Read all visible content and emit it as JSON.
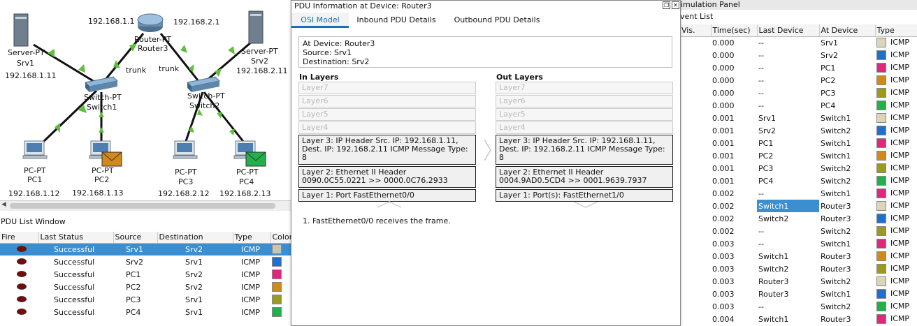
{
  "topology": {
    "router": {
      "name": "Router-PT",
      "label": "Router3",
      "ip_left": "192.168.1.1",
      "ip_right": "192.168.2.1"
    },
    "servers": [
      {
        "type": "Server-PT",
        "name": "Srv1",
        "ip": "192.168.1.11"
      },
      {
        "type": "Server-PT",
        "name": "Srv2",
        "ip": "192.168.2.11"
      }
    ],
    "switches": [
      {
        "type": "Switch-PT",
        "name": "Switch1"
      },
      {
        "type": "Switch-PT",
        "name": "Switch2"
      }
    ],
    "trunk_left": "trunk",
    "trunk_right": "trunk",
    "pcs": [
      {
        "type": "PC-PT",
        "name": "PC1",
        "ip": "192.168.1.12"
      },
      {
        "type": "PC-PT",
        "name": "PC2",
        "ip": "192.168.1.13"
      },
      {
        "type": "PC-PT",
        "name": "PC3",
        "ip": "192.168.2.12"
      },
      {
        "type": "PC-PT",
        "name": "PC4",
        "ip": "192.168.2.13"
      }
    ],
    "link_color": "#5fbf3a",
    "envelope_colors": {
      "pc2": "#d08a1c",
      "pc4": "#22b04a"
    }
  },
  "pdu_list": {
    "title": "PDU List Window",
    "columns": [
      "Fire",
      "Last Status",
      "Source",
      "Destination",
      "Type",
      "Color"
    ],
    "rows": [
      {
        "status": "Successful",
        "source": "Srv1",
        "destination": "Srv2",
        "type": "ICMP",
        "color": "#c9c5b0"
      },
      {
        "status": "Successful",
        "source": "Srv2",
        "destination": "Srv1",
        "type": "ICMP",
        "color": "#1f6fd0"
      },
      {
        "status": "Successful",
        "source": "PC1",
        "destination": "Srv2",
        "type": "ICMP",
        "color": "#e0287a"
      },
      {
        "status": "Successful",
        "source": "PC2",
        "destination": "Srv2",
        "type": "ICMP",
        "color": "#d08a1c"
      },
      {
        "status": "Successful",
        "source": "PC3",
        "destination": "Srv1",
        "type": "ICMP",
        "color": "#9a9a1c"
      },
      {
        "status": "Successful",
        "source": "PC4",
        "destination": "Srv1",
        "type": "ICMP",
        "color": "#22b04a"
      }
    ]
  },
  "pdu_dialog": {
    "title": "PDU Information at Device: Router3",
    "tabs": [
      "OSI Model",
      "Inbound PDU Details",
      "Outbound PDU Details"
    ],
    "info": {
      "line1": "At Device: Router3",
      "line2": "Source: Srv1",
      "line3": "Destination: Srv2"
    },
    "in_layers_title": "In Layers",
    "out_layers_title": "Out Layers",
    "in_layers": {
      "l7": "Layer7",
      "l6": "Layer6",
      "l5": "Layer5",
      "l4": "Layer4",
      "l3": "Layer 3: IP Header Src. IP: 192.168.1.11, Dest. IP: 192.168.2.11 ICMP Message Type: 8",
      "l2": "Layer 2: Ethernet II Header 0090.0C55.0221 >> 0000.0C76.2933",
      "l1": "Layer 1: Port FastEthernet0/0"
    },
    "out_layers": {
      "l7": "Layer7",
      "l6": "Layer6",
      "l5": "Layer5",
      "l4": "Layer4",
      "l3": "Layer 3: IP Header Src. IP: 192.168.1.11, Dest. IP: 192.168.2.11 ICMP Message Type: 8",
      "l2": "Layer 2: Ethernet II Header 0004.9AD0.5CD4 >> 0001.9639.7937",
      "l1": "Layer 1: Port(s): FastEthernet1/0"
    },
    "description": "1. FastEthernet0/0 receives the frame."
  },
  "sim_panel": {
    "title": "imulation Panel",
    "event_list_title": "vent List",
    "columns": [
      "Vis.",
      "Time(sec)",
      "Last Device",
      "At Device",
      "Type"
    ],
    "events": [
      {
        "time": "0.000",
        "last": "--",
        "at": "Srv1",
        "type": "ICMP",
        "color": "#ddd6b6"
      },
      {
        "time": "0.000",
        "last": "--",
        "at": "Srv2",
        "type": "ICMP",
        "color": "#1f6fd0"
      },
      {
        "time": "0.000",
        "last": "--",
        "at": "PC1",
        "type": "ICMP",
        "color": "#e0287a"
      },
      {
        "time": "0.000",
        "last": "--",
        "at": "PC2",
        "type": "ICMP",
        "color": "#d08a1c"
      },
      {
        "time": "0.000",
        "last": "--",
        "at": "PC3",
        "type": "ICMP",
        "color": "#9a9a1c"
      },
      {
        "time": "0.000",
        "last": "--",
        "at": "PC4",
        "type": "ICMP",
        "color": "#22b04a"
      },
      {
        "time": "0.001",
        "last": "Srv1",
        "at": "Switch1",
        "type": "ICMP",
        "color": "#ddd6b6"
      },
      {
        "time": "0.001",
        "last": "Srv2",
        "at": "Switch2",
        "type": "ICMP",
        "color": "#1f6fd0"
      },
      {
        "time": "0.001",
        "last": "PC1",
        "at": "Switch1",
        "type": "ICMP",
        "color": "#e0287a"
      },
      {
        "time": "0.001",
        "last": "PC2",
        "at": "Switch1",
        "type": "ICMP",
        "color": "#d08a1c"
      },
      {
        "time": "0.001",
        "last": "PC3",
        "at": "Switch2",
        "type": "ICMP",
        "color": "#9a9a1c"
      },
      {
        "time": "0.001",
        "last": "PC4",
        "at": "Switch2",
        "type": "ICMP",
        "color": "#22b04a"
      },
      {
        "time": "0.002",
        "last": "--",
        "at": "Switch1",
        "type": "ICMP",
        "color": "#e0287a"
      },
      {
        "time": "0.002",
        "last": "Switch1",
        "at": "Router3",
        "type": "ICMP",
        "color": "#ddd6b6"
      },
      {
        "time": "0.002",
        "last": "Switch2",
        "at": "Router3",
        "type": "ICMP",
        "color": "#1f6fd0"
      },
      {
        "time": "0.002",
        "last": "--",
        "at": "Switch2",
        "type": "ICMP",
        "color": "#9a9a1c"
      },
      {
        "time": "0.003",
        "last": "--",
        "at": "Switch1",
        "type": "ICMP",
        "color": "#e0287a"
      },
      {
        "time": "0.003",
        "last": "Switch1",
        "at": "Router3",
        "type": "ICMP",
        "color": "#d08a1c"
      },
      {
        "time": "0.003",
        "last": "Switch2",
        "at": "Router3",
        "type": "ICMP",
        "color": "#9a9a1c"
      },
      {
        "time": "0.003",
        "last": "Router3",
        "at": "Switch2",
        "type": "ICMP",
        "color": "#ddd6b6"
      },
      {
        "time": "0.003",
        "last": "Router3",
        "at": "Switch1",
        "type": "ICMP",
        "color": "#1f6fd0"
      },
      {
        "time": "0.003",
        "last": "--",
        "at": "Switch2",
        "type": "ICMP",
        "color": "#22b04a"
      },
      {
        "time": "0.004",
        "last": "Switch1",
        "at": "Router3",
        "type": "ICMP",
        "color": "#e0287a"
      }
    ]
  }
}
